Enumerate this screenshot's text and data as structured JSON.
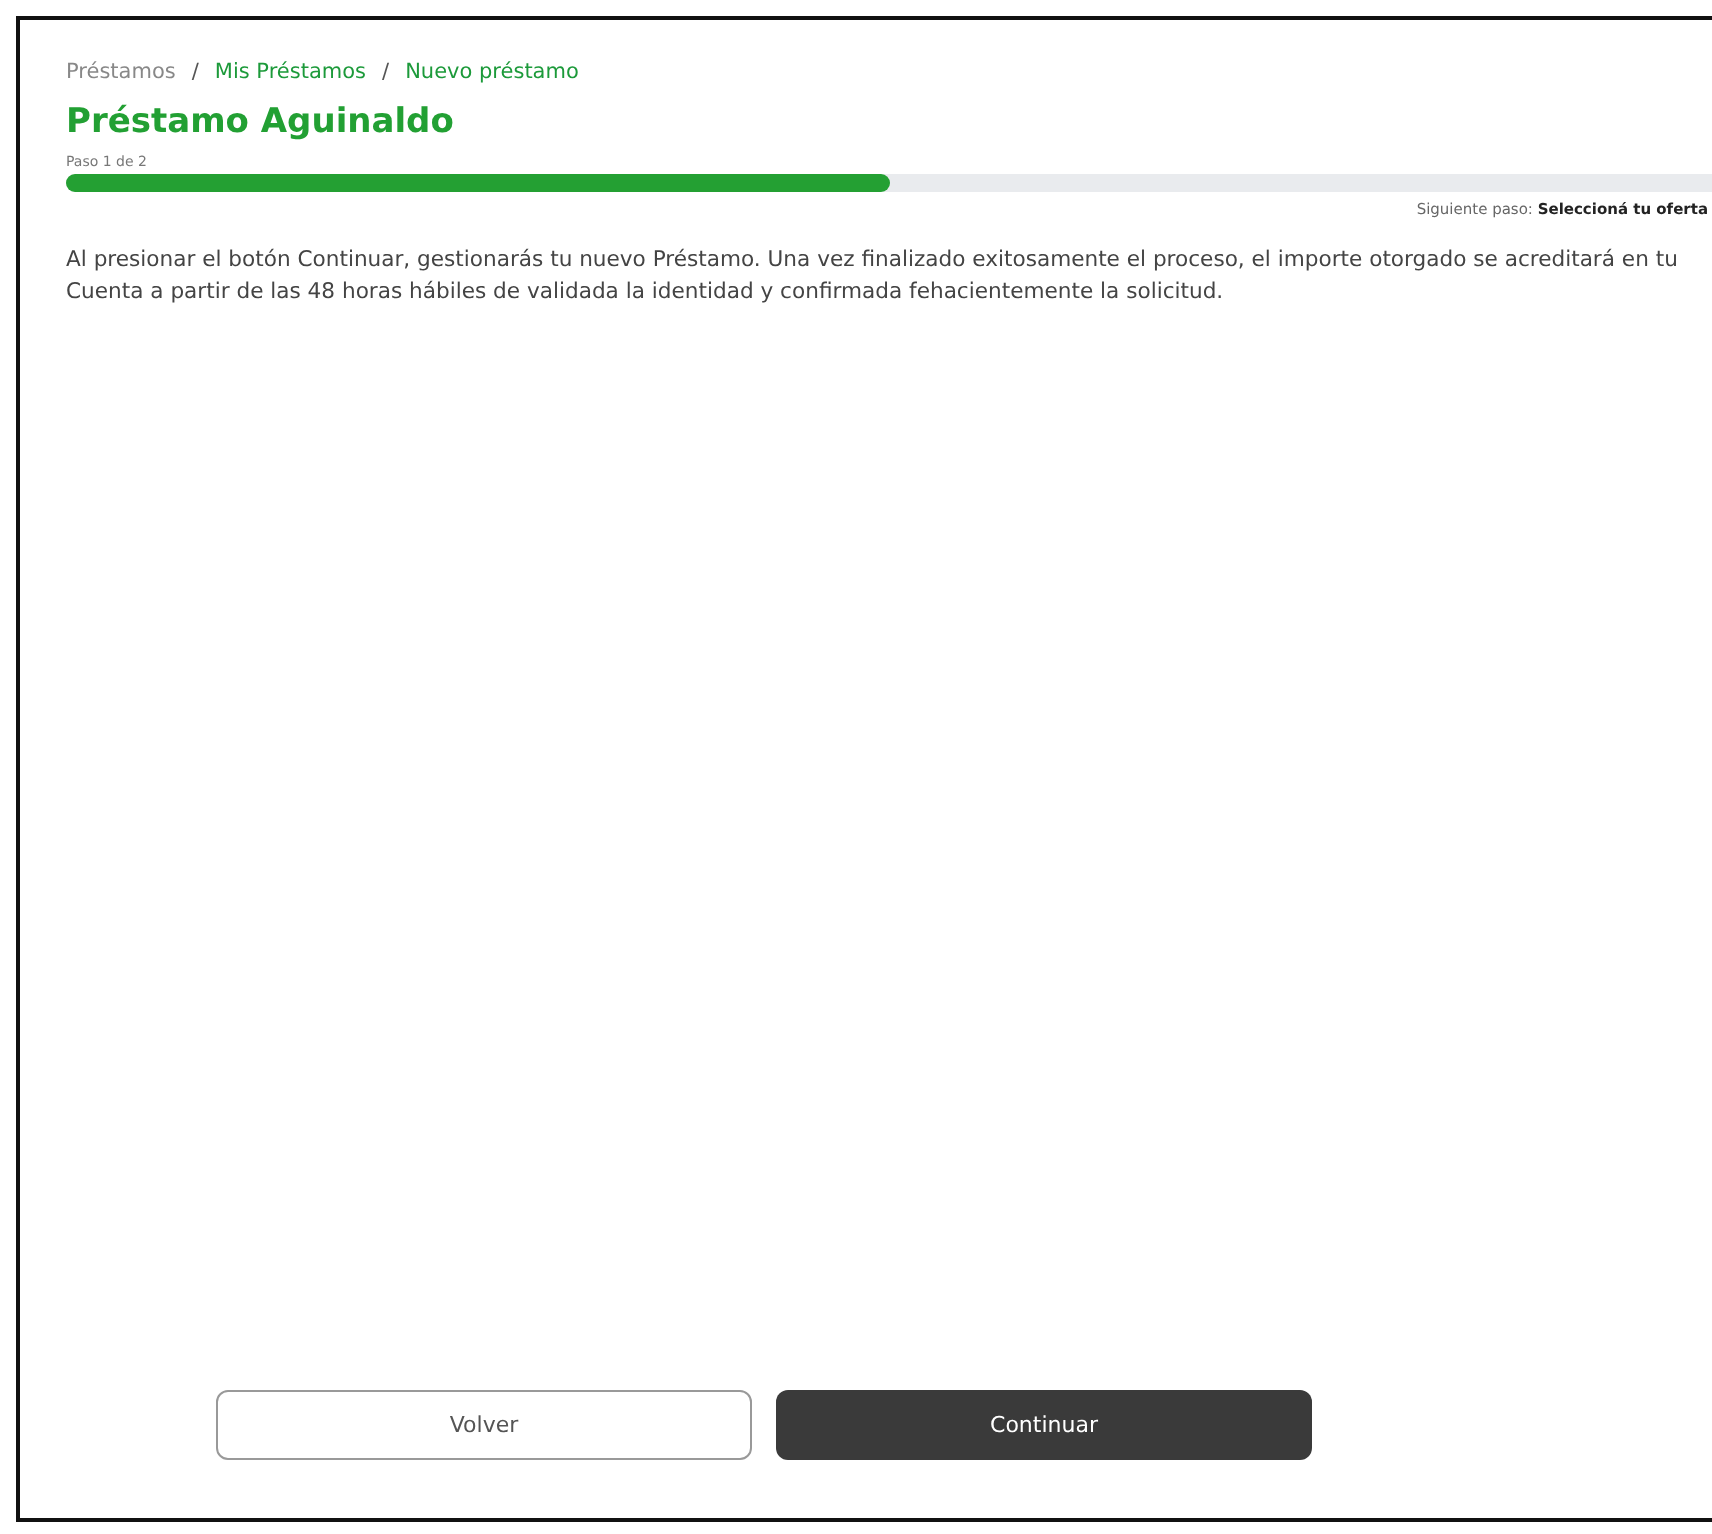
{
  "breadcrumb": {
    "separator": "/",
    "items": [
      {
        "label": "Préstamos",
        "kind": "muted"
      },
      {
        "label": "Mis Préstamos",
        "kind": "link"
      },
      {
        "label": "Nuevo préstamo",
        "kind": "link"
      }
    ]
  },
  "title": "Préstamo Aguinaldo",
  "progress": {
    "step": "Paso 1 de 2",
    "level": 0.5,
    "next": "Siguiente paso: **Seleccioná tu oferta**"
  },
  "message": "Al presionar el botón Continuar, gestionarás tu nuevo Préstamo. Una vez finalizado exitosamente el proceso, el importe otorgado se acreditará en tu Cuenta a partir de las 48 horas hábiles de validada la identidad y confirmada fehacientemente la solicitud.",
  "buttons": [
    {
      "label": "Volver",
      "kind": "secondary"
    },
    {
      "label": "Continuar",
      "kind": "primary"
    }
  ]
}
